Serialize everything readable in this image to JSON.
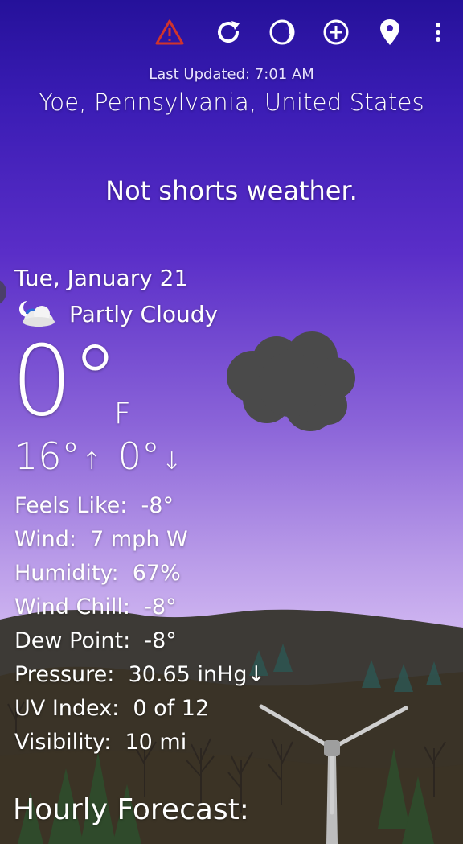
{
  "toolbar": {
    "icons": [
      "alert-icon",
      "refresh-icon",
      "moon-phase-icon",
      "add-location-icon",
      "location-pin-icon",
      "more-options-icon"
    ],
    "alert_color": "#d0342c"
  },
  "header": {
    "last_updated": "Last Updated: 7:01 AM",
    "location": "Yoe, Pennsylvania, United States"
  },
  "tagline": "Not shorts weather.",
  "current": {
    "date": "Tue, January 21",
    "condition": "Partly Cloudy",
    "condition_icon": "partly-cloudy-night-icon",
    "temperature": "0°",
    "unit": "F",
    "high": "16°",
    "high_arrow": "↑",
    "low": "0°",
    "low_arrow": "↓"
  },
  "details": [
    {
      "label": "Feels Like:",
      "value": "-8°"
    },
    {
      "label": "Wind:",
      "value": "7 mph W"
    },
    {
      "label": "Humidity:",
      "value": "67%"
    },
    {
      "label": "Wind Chill:",
      "value": "-8°"
    },
    {
      "label": "Dew Point:",
      "value": "-8°"
    },
    {
      "label": "Pressure:",
      "value": "30.65 inHg↓"
    },
    {
      "label": "UV Index:",
      "value": "0 of 12"
    },
    {
      "label": "Visibility:",
      "value": "10 mi"
    }
  ],
  "hourly_title": "Hourly Forecast:",
  "colors": {
    "sky_top": "#25119a",
    "sky_mid": "#8a63d8",
    "sky_horizon": "#cdb3f0",
    "hills": "#3b342b",
    "cloud_dark": "#4a4a4a"
  }
}
